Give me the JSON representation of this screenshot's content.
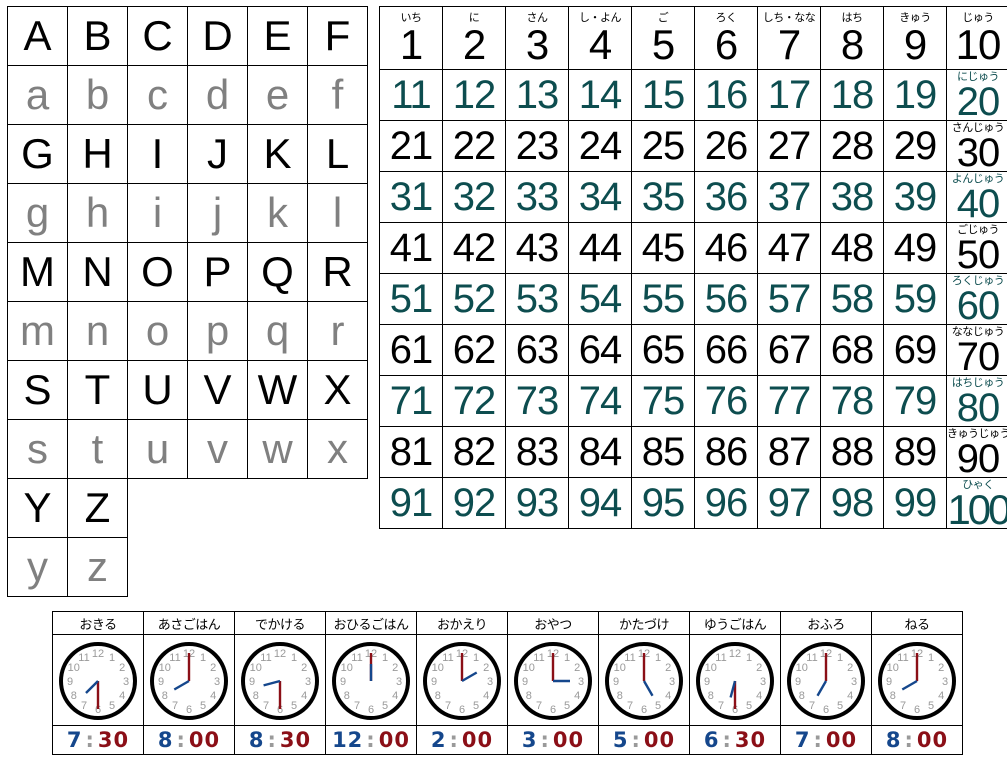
{
  "alphabet_table": {
    "name": "alphabet-chart",
    "rows": [
      {
        "case": "upper",
        "cells": [
          "A",
          "B",
          "C",
          "D",
          "E",
          "F"
        ]
      },
      {
        "case": "lower",
        "cells": [
          "a",
          "b",
          "c",
          "d",
          "e",
          "f"
        ]
      },
      {
        "case": "upper",
        "cells": [
          "G",
          "H",
          "I",
          "J",
          "K",
          "L"
        ]
      },
      {
        "case": "lower",
        "cells": [
          "g",
          "h",
          "i",
          "j",
          "k",
          "l"
        ]
      },
      {
        "case": "upper",
        "cells": [
          "M",
          "N",
          "O",
          "P",
          "Q",
          "R"
        ]
      },
      {
        "case": "lower",
        "cells": [
          "m",
          "n",
          "o",
          "p",
          "q",
          "r"
        ]
      },
      {
        "case": "upper",
        "cells": [
          "S",
          "T",
          "U",
          "V",
          "W",
          "X"
        ]
      },
      {
        "case": "lower",
        "cells": [
          "s",
          "t",
          "u",
          "v",
          "w",
          "x"
        ]
      },
      {
        "case": "upper",
        "cells": [
          "Y",
          "Z",
          "",
          "",
          "",
          ""
        ]
      },
      {
        "case": "lower",
        "cells": [
          "y",
          "z",
          "",
          "",
          "",
          ""
        ]
      }
    ],
    "upper_color": "#000000",
    "lower_color": "#808080"
  },
  "number_table": {
    "name": "numbers-1-to-100-chart",
    "header_readings": [
      "いち",
      "に",
      "さん",
      "し・よん",
      "ご",
      "ろく",
      "しち・なな",
      "はち",
      "きゅう",
      "じゅう"
    ],
    "header_numbers": [
      "1",
      "2",
      "3",
      "4",
      "5",
      "6",
      "7",
      "8",
      "9",
      "10"
    ],
    "tens_readings": [
      "じゅう",
      "にじゅう",
      "さんじゅう",
      "よんじゅう",
      "ごじゅう",
      "ろくじゅう",
      "ななじゅう",
      "はちじゅう",
      "きゅうじゅう",
      "ひゃく"
    ],
    "rows": [
      {
        "color": "teal",
        "cells": [
          "11",
          "12",
          "13",
          "14",
          "15",
          "16",
          "17",
          "18",
          "19",
          "20"
        ]
      },
      {
        "color": "black",
        "cells": [
          "21",
          "22",
          "23",
          "24",
          "25",
          "26",
          "27",
          "28",
          "29",
          "30"
        ]
      },
      {
        "color": "teal",
        "cells": [
          "31",
          "32",
          "33",
          "34",
          "35",
          "36",
          "37",
          "38",
          "39",
          "40"
        ]
      },
      {
        "color": "black",
        "cells": [
          "41",
          "42",
          "43",
          "44",
          "45",
          "46",
          "47",
          "48",
          "49",
          "50"
        ]
      },
      {
        "color": "teal",
        "cells": [
          "51",
          "52",
          "53",
          "54",
          "55",
          "56",
          "57",
          "58",
          "59",
          "60"
        ]
      },
      {
        "color": "black",
        "cells": [
          "61",
          "62",
          "63",
          "64",
          "65",
          "66",
          "67",
          "68",
          "69",
          "70"
        ]
      },
      {
        "color": "teal",
        "cells": [
          "71",
          "72",
          "73",
          "74",
          "75",
          "76",
          "77",
          "78",
          "79",
          "80"
        ]
      },
      {
        "color": "black",
        "cells": [
          "81",
          "82",
          "83",
          "84",
          "85",
          "86",
          "87",
          "88",
          "89",
          "90"
        ]
      },
      {
        "color": "teal",
        "cells": [
          "91",
          "92",
          "93",
          "94",
          "95",
          "96",
          "97",
          "98",
          "99",
          "100"
        ]
      }
    ],
    "teal_color": "#0d4d4f",
    "black_color": "#000000"
  },
  "schedule_table": {
    "name": "daily-routine-clock-chart",
    "clock_numerals": [
      "1",
      "2",
      "3",
      "4",
      "5",
      "6",
      "7",
      "8",
      "9",
      "10",
      "11",
      "12"
    ],
    "hour_hand_color": "#15478c",
    "minute_hand_color": "#8b0f17",
    "numeral_color": "#9a9a9a",
    "digital_hour_color": "#15478c",
    "digital_minute_color": "#8b0f17",
    "items": [
      {
        "label": "おきる",
        "hour": "7",
        "minute": "30",
        "h_deg": 225,
        "m_deg": 180
      },
      {
        "label": "あさごはん",
        "hour": "8",
        "minute": "00",
        "h_deg": 240,
        "m_deg": 0
      },
      {
        "label": "でかける",
        "hour": "8",
        "minute": "30",
        "h_deg": 255,
        "m_deg": 180
      },
      {
        "label": "おひるごはん",
        "hour": "12",
        "minute": "00",
        "h_deg": 0,
        "m_deg": 0
      },
      {
        "label": "おかえり",
        "hour": "2",
        "minute": "00",
        "h_deg": 60,
        "m_deg": 0
      },
      {
        "label": "おやつ",
        "hour": "3",
        "minute": "00",
        "h_deg": 90,
        "m_deg": 0
      },
      {
        "label": "かたづけ",
        "hour": "5",
        "minute": "00",
        "h_deg": 150,
        "m_deg": 0
      },
      {
        "label": "ゆうごはん",
        "hour": "6",
        "minute": "30",
        "h_deg": 195,
        "m_deg": 180
      },
      {
        "label": "おふろ",
        "hour": "7",
        "minute": "00",
        "h_deg": 210,
        "m_deg": 0
      },
      {
        "label": "ねる",
        "hour": "8",
        "minute": "00",
        "h_deg": 240,
        "m_deg": 0
      }
    ]
  }
}
